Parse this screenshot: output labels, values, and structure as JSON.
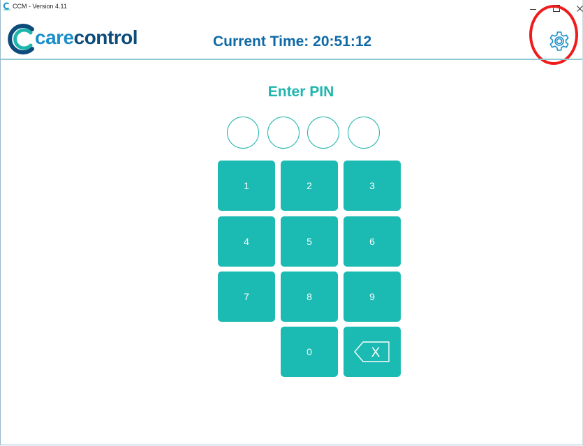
{
  "window": {
    "title": "CCM - Version 4.11",
    "icon": "carecontrol-app-icon",
    "controls": [
      "minimize-icon",
      "maximize-icon",
      "close-icon"
    ]
  },
  "header": {
    "logo": {
      "part1": "care",
      "part2": "control",
      "icon": "carecontrol-logo-icon"
    },
    "current_time": "Current Time: 20:51:12",
    "settings_icon": "gear-icon"
  },
  "pin": {
    "title": "Enter PIN",
    "length": 4,
    "entered": 0
  },
  "keypad": {
    "keys": [
      "1",
      "2",
      "3",
      "4",
      "5",
      "6",
      "7",
      "8",
      "9",
      "0"
    ],
    "backspace_label": "X",
    "backspace_icon": "backspace-icon"
  },
  "colors": {
    "accent": "#1bbab2",
    "time_text": "#0e6aa6",
    "logo_care": "#1a8fc9",
    "logo_control": "#0d4b7a",
    "highlight": "#ee1c1c"
  }
}
